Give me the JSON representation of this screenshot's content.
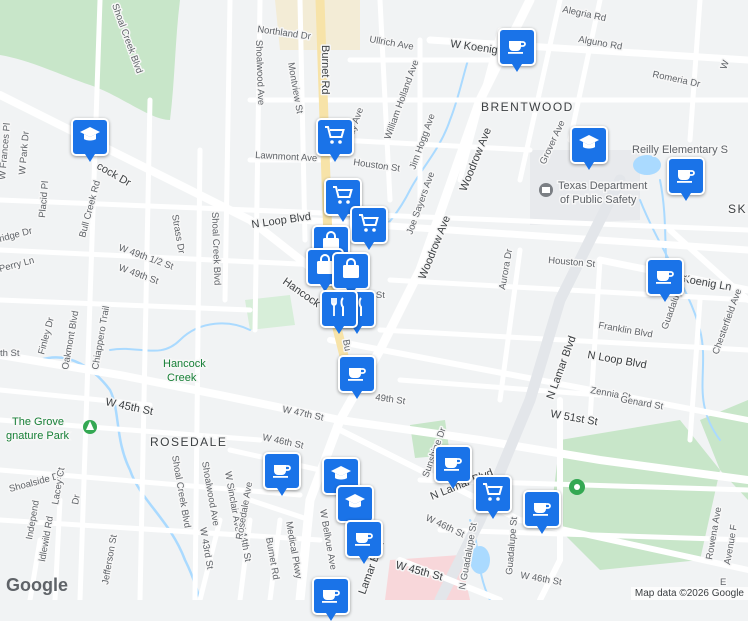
{
  "attribution": "Map data ©2026 Google",
  "logo": "Google",
  "neighborhoods": {
    "brentwood": "BRENTWOOD",
    "rosedale": "ROSEDALE",
    "sk": "SK"
  },
  "places": {
    "hancock_creek_1": "Hancock",
    "hancock_creek_2": "Creek",
    "grove_1": "The Grove",
    "grove_2": "gnature Park",
    "dps_1": "Texas Department",
    "dps_2": "of Public Safety",
    "reilly": "Reilly Elementary S"
  },
  "streets": {
    "northland": "Northland Dr",
    "shoal_creek_top": "Shoal Creek Blvd",
    "burnet_top": "Burnet Rd",
    "montview": "Montview St",
    "shoalwood_top": "Shoalwood Ave",
    "ullrich": "Ullrich Ave",
    "koenig_top": "W Koenig Ln",
    "alguno": "Alguno Rd",
    "romeria": "Romeria Dr",
    "alegria": "Alegria Rd",
    "w_top": "W",
    "william_holland": "William Holland Ave",
    "jay_ave": "Jay Ave",
    "houston_top": "Houston St",
    "lawnmont": "Lawnmont Ave",
    "jim_hogg": "Jim Hogg Ave",
    "joe_sayers": "Joe Sayers Ave",
    "woodrow_1": "Woodrow Ave",
    "woodrow_2": "Woodrow Ave",
    "grover": "Grover Ave",
    "n_loop": "N Loop Blvd",
    "hancock_dr_top": "cock Dr",
    "w_frances": "W Frances Pl",
    "w_park": "W Park Dr",
    "placid": "Placid Pl",
    "bull_creek": "Bull Creek Rd",
    "strass": "Strass Dr",
    "w_49_half": "W 49th 1/2 St",
    "w_49_left": "W 49th St",
    "ridge": "ridge Dr",
    "perry": "Perry Ln",
    "shoal_creek_mid": "Shoal Creek Blvd",
    "finley": "Finley Dr",
    "oakmont": "Oakmont Blvd",
    "chiappero": "Chiappero Trail",
    "hancock_dr_mid": "Hancock",
    "h_st": "h St",
    "bu": "Bu",
    "houston_right": "Houston St",
    "aurora": "Aurora Dr",
    "koenig_right": "Koenig Ln",
    "n_lamar_right": "N Lamar Blvd",
    "franklin": "Franklin Blvd",
    "n_loop_right": "N Loop Blvd",
    "guadalupe_right": "Guadalupe St",
    "chesterfield": "Chesterfield Ave",
    "zennia": "Zennia St",
    "genard": "Genard St",
    "w_51": "W 51st St",
    "w_49_mid": "49th St",
    "th_st": "th St",
    "w_45_left": "W 45th St",
    "w_47": "W 47th St",
    "w_46_left": "W 46th St",
    "shoalside": "Shoalside Dr",
    "lacey": "Lacey Ct",
    "dr": "Dr",
    "independence": "Independ",
    "idlewild": "ldlewild Rd",
    "jefferson": "Jefferson St",
    "shoal_creek_bot": "Shoal Creek Blvd",
    "shoalwood_bot": "Shoalwood Ave",
    "w_sinclair": "W Sinclair Ave",
    "w_44": "W 44th St",
    "w_43": "W 43rd St",
    "rosedale_ave": "Rosedale Ave",
    "burnet_bot": "Burnet Rd",
    "medical_pkwy": "Medical Pkwy",
    "w_bellvue": "W Bellvue Ave",
    "lamar_bot": "Lamar Blvd",
    "w_45_bot": "W 45th St",
    "sunshine": "Sunshine Dr",
    "n_lamar_mid": "N Lamar Blvd",
    "w_46_mid": "W 46th St",
    "guadalupe_bot": "Guadalupe St",
    "w_46_bot": "W 46th St",
    "n_guadalupe": "N Guadalupe St",
    "rowena": "Rowena Ave",
    "avenue_f": "Avenue F",
    "e": "E"
  },
  "colors": {
    "marker": "#1a73e8",
    "water": "#aadaff",
    "park": "#c8e6c9",
    "road": "#ffffff",
    "highway": "#e3e6ea",
    "burnet": "#f7e3a8",
    "background": "#f1f3f4"
  },
  "markers": [
    {
      "icon": "coffee-icon"
    },
    {
      "icon": "school-icon"
    },
    {
      "icon": "school-icon"
    },
    {
      "icon": "coffee-icon"
    },
    {
      "icon": "coffee-icon"
    },
    {
      "icon": "shopping-cart-icon"
    },
    {
      "icon": "shopping-cart-icon"
    },
    {
      "icon": "shopping-cart-icon"
    },
    {
      "icon": "shopping-bag-icon"
    },
    {
      "icon": "shopping-bag-icon"
    },
    {
      "icon": "shopping-bag-icon"
    },
    {
      "icon": "restaurant-icon"
    },
    {
      "icon": "restaurant-icon"
    },
    {
      "icon": "coffee-icon"
    },
    {
      "icon": "coffee-icon"
    },
    {
      "icon": "coffee-icon"
    },
    {
      "icon": "shopping-cart-icon"
    },
    {
      "icon": "coffee-icon"
    },
    {
      "icon": "school-icon"
    },
    {
      "icon": "school-icon"
    },
    {
      "icon": "coffee-icon"
    },
    {
      "icon": "coffee-icon"
    }
  ]
}
